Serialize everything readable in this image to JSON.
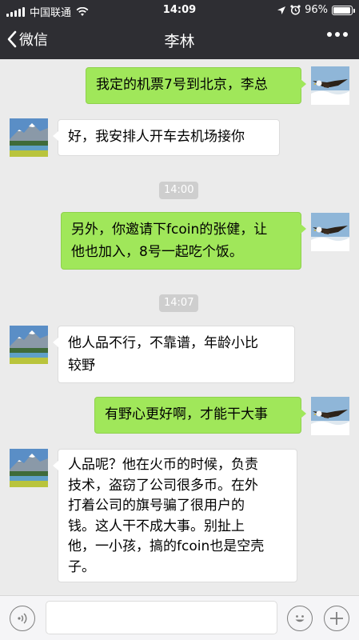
{
  "status_bar": {
    "carrier": "中国联通",
    "time": "14:09",
    "battery": "96%",
    "battery_level": 0.96
  },
  "nav": {
    "back_label": "微信",
    "title": "李林"
  },
  "messages": [
    {
      "from": "me",
      "text": "我定的机票7号到北京，李总"
    },
    {
      "from": "them",
      "text": "好，我安排人开车去机场接你"
    },
    {
      "from": "time",
      "text": "14:00"
    },
    {
      "from": "me",
      "line1": "另外，你邀请下fcoin的张健，让",
      "line2": "他也加入，8号一起吃个饭。"
    },
    {
      "from": "time",
      "text": "14:07"
    },
    {
      "from": "them",
      "line1": "他人品不行，不靠谱，年龄小比",
      "line2": "较野"
    },
    {
      "from": "me",
      "text": "有野心更好啊，才能干大事"
    },
    {
      "from": "them",
      "line1": "人品呢？他在火币的时候，负责",
      "line2": "技术，盗窃了公司很多币。在外",
      "line3": "打着公司的旗号骗了很用户的",
      "line4": "钱。这人干不成大事。别扯上",
      "line5": "他，一小孩，搞的fcoin也是空壳",
      "line6": "子。"
    }
  ],
  "input": {
    "placeholder": ""
  },
  "icons": {
    "wifi": "wifi-icon",
    "location": "location-arrow-icon",
    "alarm": "alarm-icon",
    "voice": "voice-icon",
    "emoji": "emoji-icon",
    "plus": "plus-icon"
  },
  "colors": {
    "header_bg": "#2e2e33",
    "chat_bg": "#ebebeb",
    "my_bubble": "#a0e75a",
    "their_bubble": "#ffffff"
  }
}
